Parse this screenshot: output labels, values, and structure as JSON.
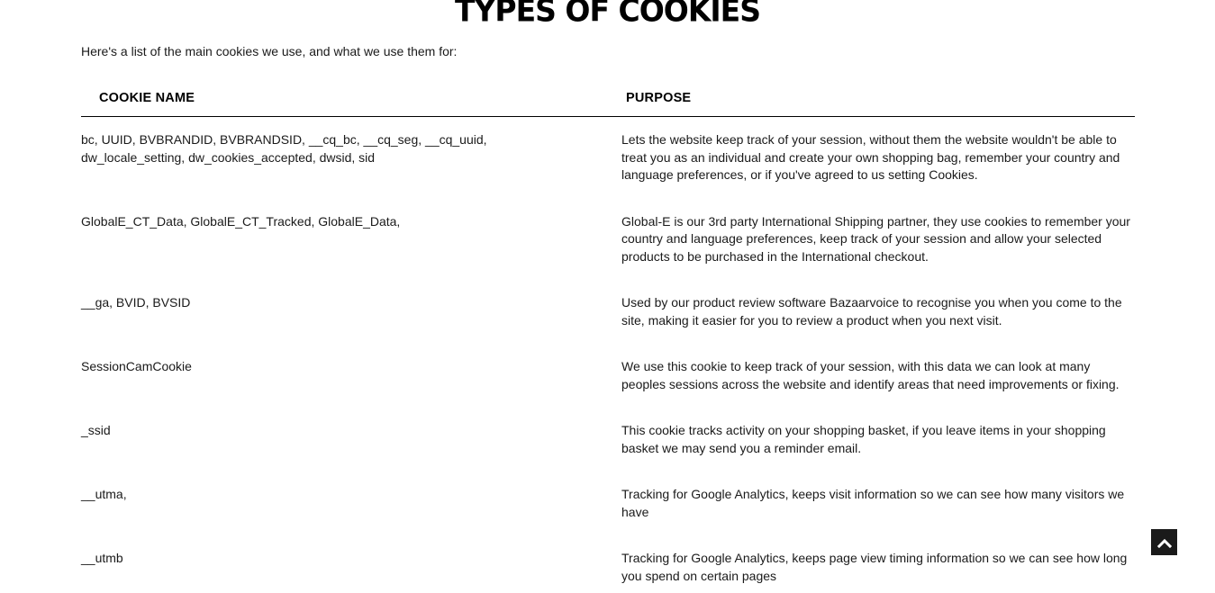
{
  "page": {
    "title": "TYPES OF COOKIES",
    "intro": "Here's a list of the main cookies we use, and what we use them for:"
  },
  "table": {
    "headers": {
      "name": "COOKIE NAME",
      "purpose": "PURPOSE"
    },
    "rows": [
      {
        "name": "bc, UUID, BVBRANDID, BVBRANDSID, __cq_bc, __cq_seg, __cq_uuid, dw_locale_setting, dw_cookies_accepted, dwsid, sid",
        "purpose": "Lets the website keep track of your session, without them the website wouldn't be able to treat you as an individual and create your own shopping bag, remember your country and language preferences, or if you've agreed to us setting Cookies."
      },
      {
        "name": "GlobalE_CT_Data, GlobalE_CT_Tracked, GlobalE_Data,",
        "purpose": "Global-E is our 3rd party International Shipping partner, they use cookies to remember your country and language preferences, keep track of your session and allow your selected products to be purchased in the International checkout."
      },
      {
        "name": "__ga, BVID, BVSID",
        "purpose": "Used by our product review software Bazaarvoice to recognise you when you come to the site, making it easier for you to review a product when you next visit."
      },
      {
        "name": "SessionCamCookie",
        "purpose": "We use this cookie to keep track of your session, with this data we can look at many peoples sessions across the website and identify areas that need improvements or fixing."
      },
      {
        "name": "_ssid",
        "purpose": "This cookie tracks activity on your shopping basket, if you leave items in your shopping basket we may send you a reminder email."
      },
      {
        "name": "__utma,",
        "purpose": "Tracking for Google Analytics, keeps visit information so we can see how many visitors we have"
      },
      {
        "name": "__utmb",
        "purpose": "Tracking for Google Analytics, keeps page view timing information so we can see how long you spend on certain pages"
      }
    ]
  },
  "back_to_top": {
    "icon": "chevron-up-icon"
  }
}
